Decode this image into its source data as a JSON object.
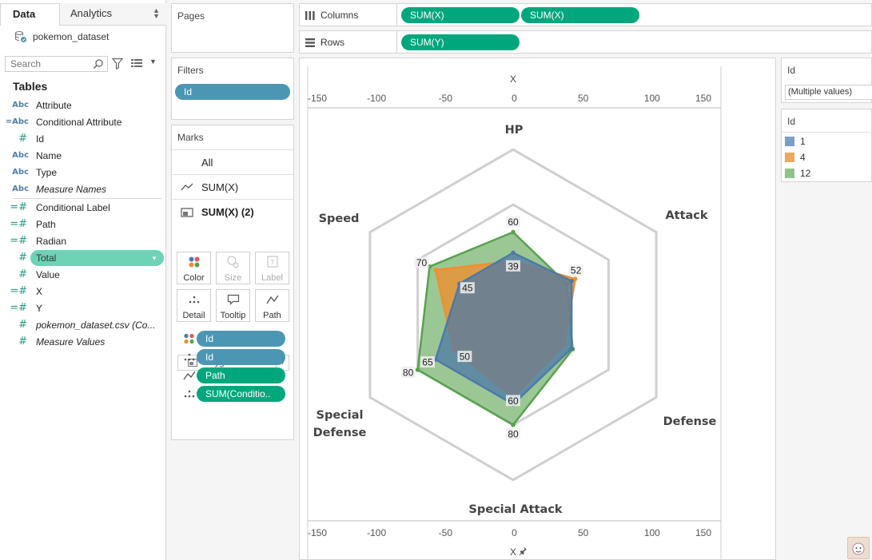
{
  "left_pane": {
    "tabs": [
      "Data",
      "Analytics"
    ],
    "datasource": "pokemon_dataset",
    "search_placeholder": "Search",
    "tables_heading": "Tables",
    "fields": [
      {
        "type": "Abc",
        "name": "Attribute",
        "italic": false
      },
      {
        "type": "=Abc",
        "name": "Conditional Attribute",
        "italic": false
      },
      {
        "type": "#",
        "name": "Id",
        "italic": false
      },
      {
        "type": "Abc",
        "name": "Name",
        "italic": false
      },
      {
        "type": "Abc",
        "name": "Type",
        "italic": false
      },
      {
        "type": "Abc",
        "name": "Measure Names",
        "italic": true
      },
      {
        "type": "=#",
        "name": "Conditional Label",
        "italic": false
      },
      {
        "type": "=#",
        "name": "Path",
        "italic": false
      },
      {
        "type": "=#",
        "name": "Radian",
        "italic": false
      },
      {
        "type": "#",
        "name": "Total",
        "italic": false
      },
      {
        "type": "#",
        "name": "Value",
        "italic": false
      },
      {
        "type": "=#",
        "name": "X",
        "italic": false
      },
      {
        "type": "=#",
        "name": "Y",
        "italic": false
      },
      {
        "type": "#",
        "name": "pokemon_dataset.csv (Co...",
        "italic": true
      },
      {
        "type": "#",
        "name": "Measure Values",
        "italic": true
      }
    ]
  },
  "pages": {
    "title": "Pages"
  },
  "filters": {
    "title": "Filters",
    "pills": [
      "Id"
    ]
  },
  "marks": {
    "title": "Marks",
    "cards": [
      "All",
      "SUM(X)",
      "SUM(X) (2)"
    ],
    "mark_type": "Polygon",
    "buttons": [
      "Color",
      "Size",
      "Label",
      "Detail",
      "Tooltip",
      "Path"
    ],
    "encodings": [
      {
        "icon": "color-icon",
        "label": "Id",
        "color": "blue"
      },
      {
        "icon": "detail-icon",
        "label": "Id",
        "color": "blue"
      },
      {
        "icon": "path-icon",
        "label": "Path",
        "color": "green"
      },
      {
        "icon": "detail-icon",
        "label": "SUM(Conditio..",
        "color": "green"
      }
    ]
  },
  "shelves": {
    "columns": {
      "label": "Columns",
      "pills": [
        "SUM(X)",
        "SUM(X)"
      ]
    },
    "rows": {
      "label": "Rows",
      "pills": [
        "SUM(Y)"
      ]
    }
  },
  "id_filter_card": {
    "title": "Id",
    "value": "(Multiple values)"
  },
  "id_legend": {
    "title": "Id",
    "items": [
      {
        "label": "1",
        "color": "#7b9fc4"
      },
      {
        "label": "4",
        "color": "#f0a85a"
      },
      {
        "label": "12",
        "color": "#90c48a"
      }
    ]
  },
  "chart_data": {
    "type": "radar",
    "axis_title_top": "X",
    "axis_title_bottom": "X",
    "x_ticks": [
      -150,
      -100,
      -50,
      0,
      50,
      100,
      150
    ],
    "xlim": [
      -150,
      150
    ],
    "attributes": [
      "HP",
      "Attack",
      "Defense",
      "Special Attack",
      "Special Defense",
      "Speed"
    ],
    "attribute_label_lines": [
      [
        "HP"
      ],
      [
        "Attack"
      ],
      [
        "Defense"
      ],
      [
        "Special Attack"
      ],
      [
        "Special",
        "Defense"
      ],
      [
        "Speed"
      ]
    ],
    "ring_values": [
      40,
      80,
      120
    ],
    "series": [
      {
        "name": "1",
        "color": "#4e79a7",
        "values": [
          45,
          49,
          49,
          65,
          65,
          45
        ]
      },
      {
        "name": "4",
        "color": "#f28e2b",
        "values": [
          39,
          52,
          43,
          60,
          50,
          65
        ]
      },
      {
        "name": "12",
        "color": "#59a14f",
        "values": [
          60,
          45,
          50,
          80,
          80,
          70
        ]
      }
    ],
    "data_labels": [
      {
        "text": "60",
        "attr": 0,
        "value": 60
      },
      {
        "text": "39",
        "attr": 0,
        "value": 39
      },
      {
        "text": "52",
        "attr": 1,
        "value": 52
      },
      {
        "text": "60",
        "attr": 3,
        "value": 60
      },
      {
        "text": "80",
        "attr": 3,
        "value": 80
      },
      {
        "text": "50",
        "attr": 4,
        "value": 50
      },
      {
        "text": "65",
        "attr": 4,
        "value": 65
      },
      {
        "text": "80",
        "attr": 4,
        "value": 80
      },
      {
        "text": "45",
        "attr": 5,
        "value": 45
      },
      {
        "text": "70",
        "attr": 5,
        "value": 70
      }
    ]
  }
}
